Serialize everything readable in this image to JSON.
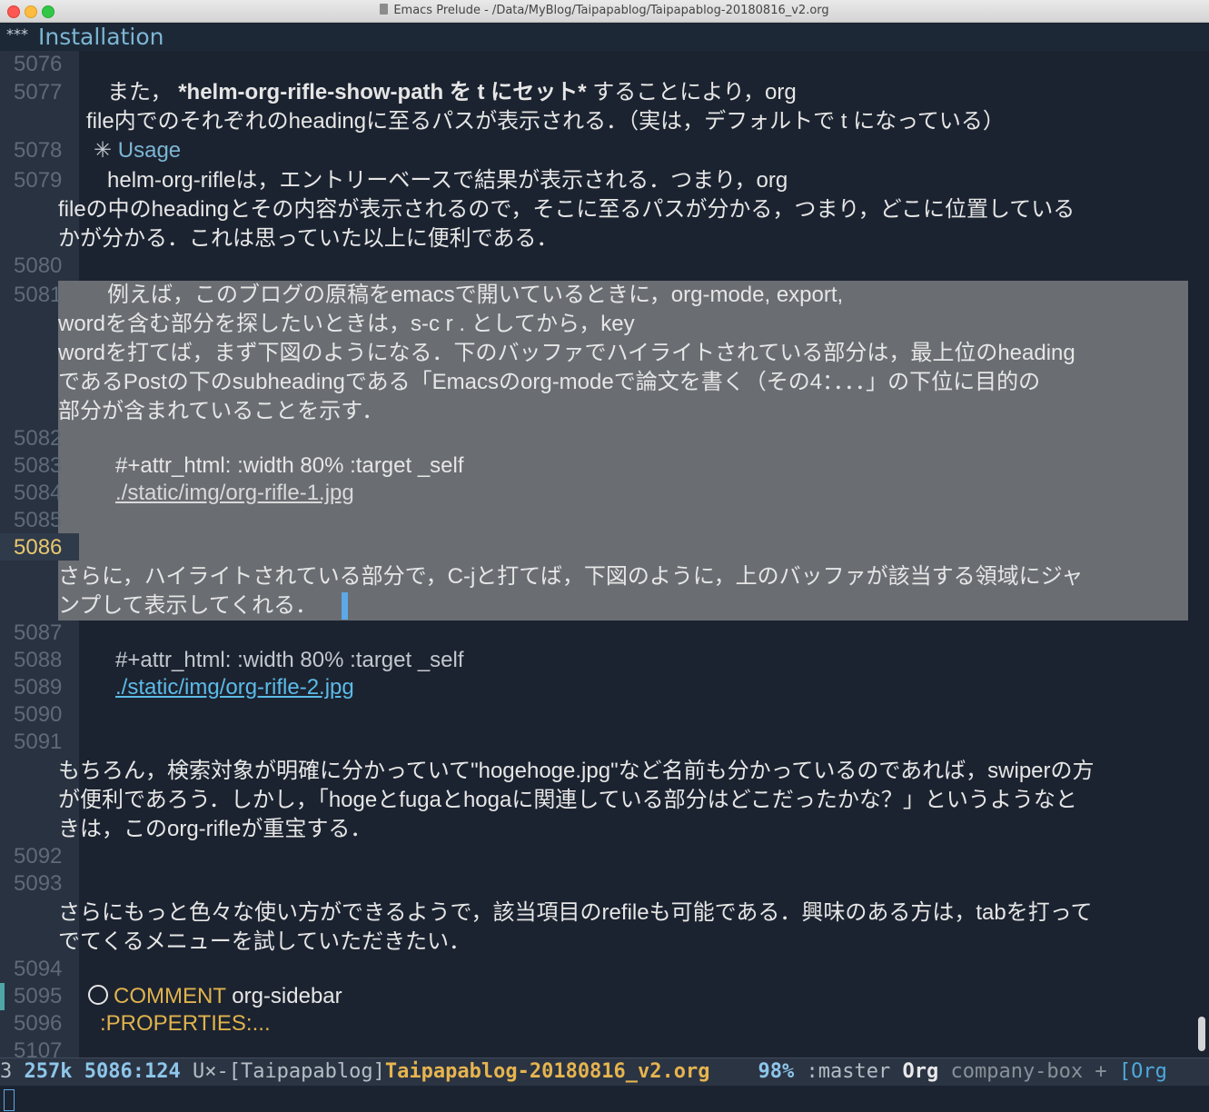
{
  "window": {
    "title": "Emacs Prelude - /Data/MyBlog/Taipapablog/Taipapablog-20180816_v2.org"
  },
  "header": {
    "stars": "***",
    "heading": "Installation"
  },
  "line_numbers": {
    "n5076": "5076",
    "n5077": "5077",
    "n5078": "5078",
    "n5079": "5079",
    "n5080": "5080",
    "n5081": "5081",
    "n5082": "5082",
    "n5083": "5083",
    "n5084": "5084",
    "n5085": "5085",
    "n5086": "5086",
    "n5087": "5087",
    "n5088": "5088",
    "n5089": "5089",
    "n5090": "5090",
    "n5091": "5091",
    "n5092": "5092",
    "n5093": "5093",
    "n5094": "5094",
    "n5095": "5095",
    "n5096": "5096",
    "n5107": "5107"
  },
  "content": {
    "l5077a_pre": "また，",
    "l5077a_bold": "*helm-org-rifle-show-path を t にセット*",
    "l5077a_post": "することにより，org",
    "l5077b": "file内でのそれぞれのheadingに至るパスが表示される．（実は，デフォルトで t になっている）",
    "l5078_bullet": "✳",
    "l5078_heading": "Usage",
    "l5079a": "helm-org-rifleは，エントリーベースで結果が表示される．つまり，org",
    "l5079b": "fileの中のheadingとその内容が表示されるので，そこに至るパスが分かる，つまり，どこに位置している",
    "l5079c": "かが分かる．これは思っていた以上に便利である．",
    "l5081a": "例えば，このブログの原稿をemacsで開いているときに，org-mode, export,",
    "l5081b": "wordを含む部分を探したいときは，s-c r . としてから，key",
    "l5081c": "wordを打てば，まず下図のようになる．下のバッファでハイライトされている部分は，最上位のheading",
    "l5081d": "であるPostの下のsubheadingである「Emacsのorg-modeで論文を書く（その4：．．．」の下位に目的の",
    "l5081e": "部分が含まれていることを示す．",
    "l5083": "#+attr_html: :width 80% :target _self",
    "l5084": "./static/img/org-rifle-1.jpg",
    "l5086a": "さらに，ハイライトされている部分で，C-jと打てば，下図のように，上のバッファが該当する領域にジャ",
    "l5086b": "ンプして表示してくれる．",
    "l5088": "#+attr_html: :width 80% :target _self",
    "l5089": "./static/img/org-rifle-2.jpg",
    "l5091a": "もちろん，検索対象が明確に分かっていて\"hogehoge.jpg\"など名前も分かっているのであれば，swiperの方",
    "l5091b": "が便利であろう．しかし，「hogeとfugaとhogaに関連している部分はどこだったかな？」というようなと",
    "l5091c": "きは，このorg-rifleが重宝する．",
    "l5093a": "さらにもっと色々な使い方ができるようで，該当項目のrefileも可能である．興味のある方は，tabを打って",
    "l5093b": "でてくるメニューを試していただきたい．",
    "l5095_kw": "COMMENT",
    "l5095_title": "org-sidebar",
    "l5096": ":PROPERTIES:..."
  },
  "modeline": {
    "workspace": "3",
    "size": "257k",
    "position": "5086:124",
    "encoding": "U×-",
    "project": "[Taipapablog]",
    "filename": "Taipapablog-20180816_v2.org",
    "percent": "98%",
    "branch": ":master",
    "mode": "Org",
    "minor": "company-box",
    "plus": "+",
    "extra": "[Org"
  },
  "colors": {
    "background": "#1c2330",
    "region": "#6a6d72",
    "heading": "#7cb6d4",
    "keyword": "#e0b34c",
    "link": "#5bbbe8"
  }
}
